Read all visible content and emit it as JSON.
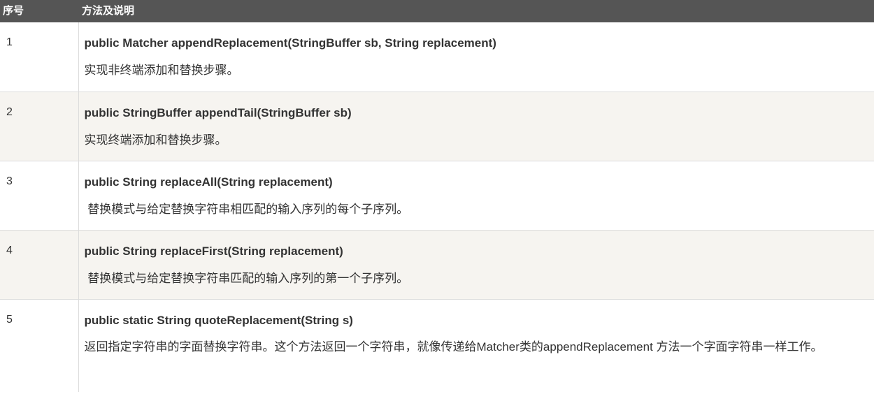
{
  "header": {
    "col_num": "序号",
    "col_desc": "方法及说明"
  },
  "rows": [
    {
      "num": "1",
      "signature": "public Matcher appendReplacement(StringBuffer sb, String replacement)",
      "description": "实现非终端添加和替换步骤。"
    },
    {
      "num": "2",
      "signature": "public StringBuffer appendTail(StringBuffer sb)",
      "description": "实现终端添加和替换步骤。"
    },
    {
      "num": "3",
      "signature": "public String replaceAll(String replacement)",
      "description": " 替换模式与给定替换字符串相匹配的输入序列的每个子序列。"
    },
    {
      "num": "4",
      "signature": "public String replaceFirst(String replacement)",
      "description": " 替换模式与给定替换字符串匹配的输入序列的第一个子序列。"
    },
    {
      "num": "5",
      "signature": "public static String quoteReplacement(String s)",
      "description": "返回指定字符串的字面替换字符串。这个方法返回一个字符串，就像传递给Matcher类的appendReplacement 方法一个字面字符串一样工作。"
    }
  ]
}
